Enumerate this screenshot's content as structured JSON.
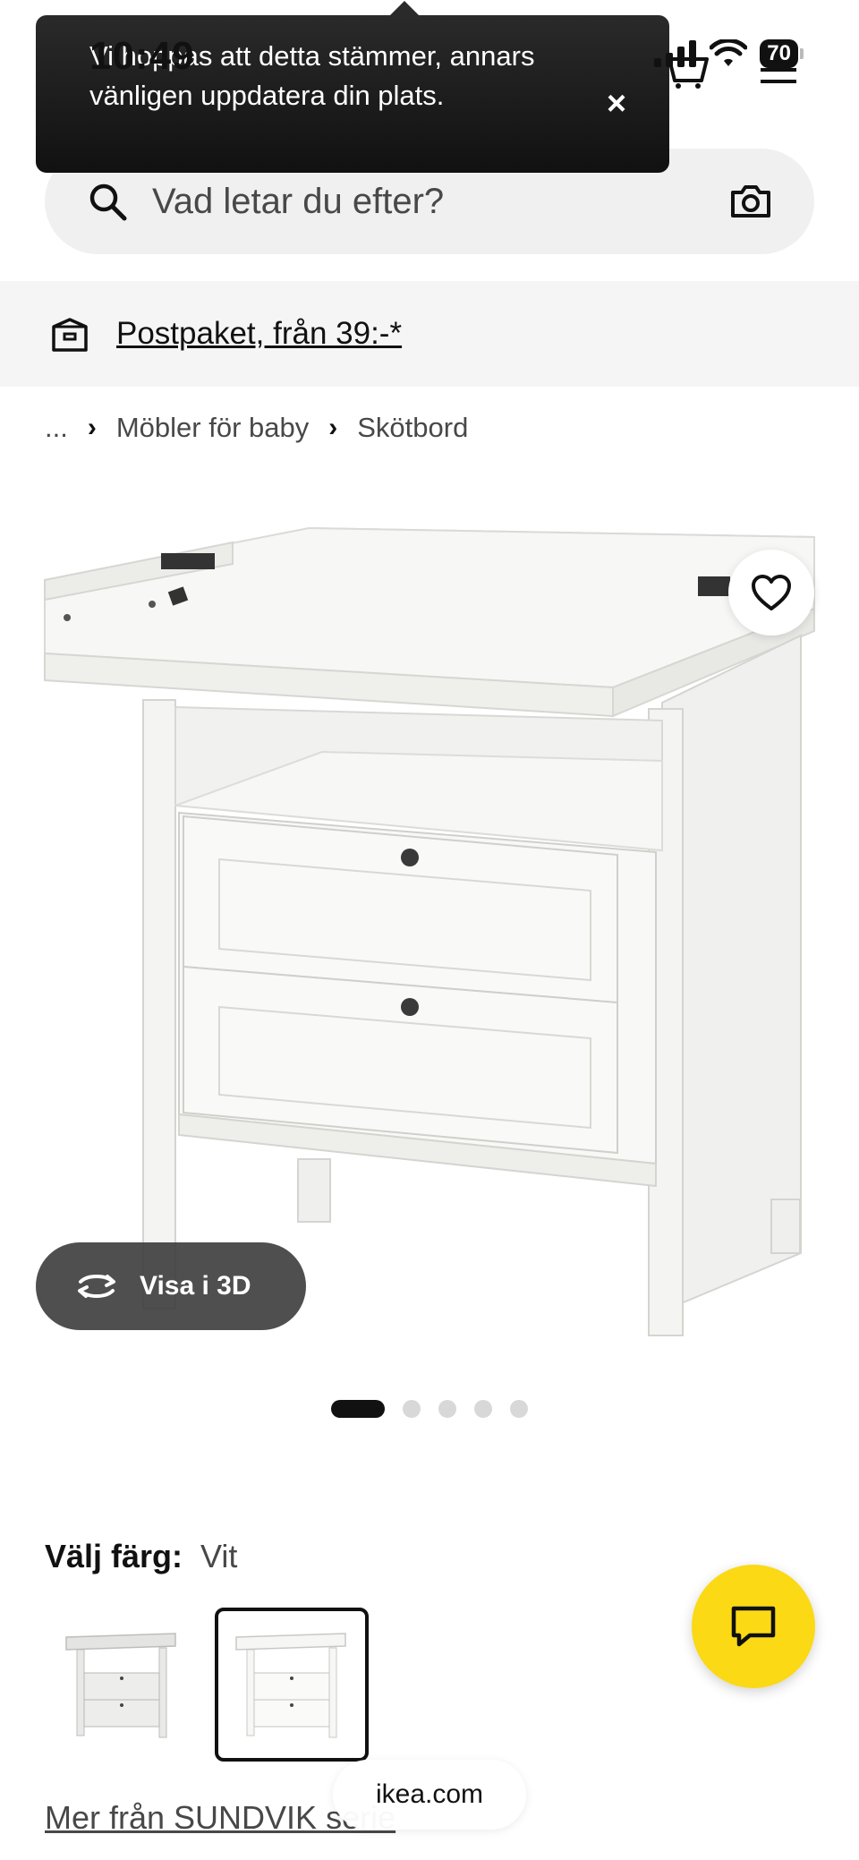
{
  "status_bar": {
    "time": "10:49",
    "battery": "70"
  },
  "toast": {
    "text": "Vi hoppas att detta stämmer, annars vänligen uppdatera din plats.",
    "close_label": "×"
  },
  "search": {
    "placeholder": "Vad letar du efter?"
  },
  "delivery": {
    "link": "Postpaket, från 39:-*"
  },
  "breadcrumb": {
    "ellipsis": "...",
    "items": [
      "Möbler för baby",
      "Skötbord"
    ],
    "separator": "›"
  },
  "product_view": {
    "view_3d_label": "Visa i 3D",
    "carousel_count": 5,
    "carousel_active_index": 0
  },
  "color_selection": {
    "label": "Välj färg:",
    "value": "Vit"
  },
  "series_link": "Mer från SUNDVIK serie",
  "browser": {
    "url": "ikea.com"
  },
  "colors": {
    "accent_yellow": "#fbd914",
    "toast_bg": "#1e1e1e"
  },
  "icons": [
    "search-icon",
    "camera-icon",
    "parcel-icon",
    "heart-icon",
    "rotate-3d-icon",
    "chat-icon",
    "cart-icon",
    "menu-icon",
    "signal-icon",
    "wifi-icon"
  ]
}
